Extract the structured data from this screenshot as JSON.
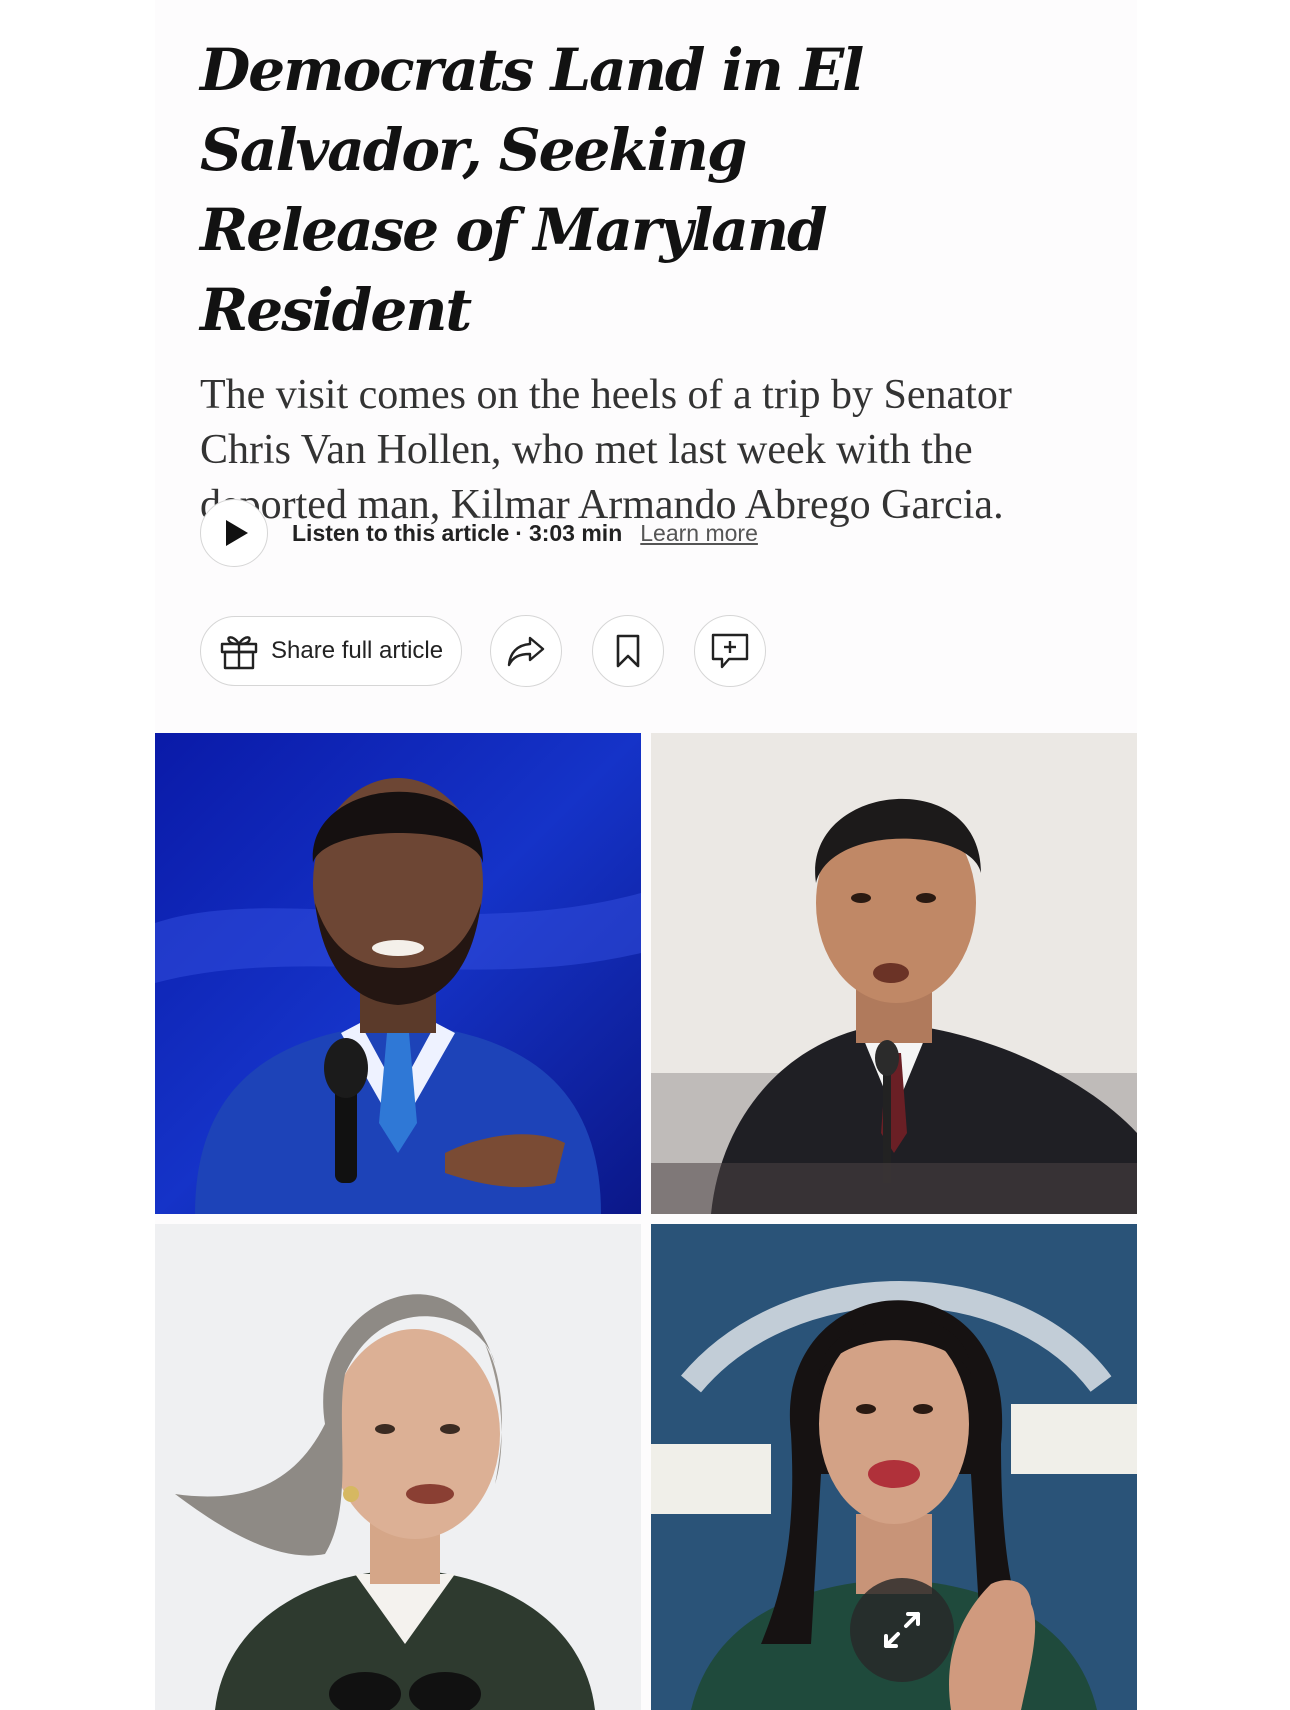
{
  "article": {
    "headline": "Democrats Land in El Salvador, Seeking Release of Maryland Resident",
    "summary": "The visit comes on the heels of a trip by Senator Chris Van Hollen, who met last week with the deported man, Kilmar Armando Abrego Garcia."
  },
  "audio": {
    "listen_label": "Listen to this article",
    "separator": "·",
    "duration": "3:03 min",
    "learn_more": "Learn more"
  },
  "actions": {
    "share_full_label": "Share full article",
    "icons": [
      "gift-icon",
      "share-icon",
      "bookmark-icon",
      "comment-icon"
    ]
  },
  "photos": {
    "count": 4,
    "expand_icon": "expand-icon"
  }
}
